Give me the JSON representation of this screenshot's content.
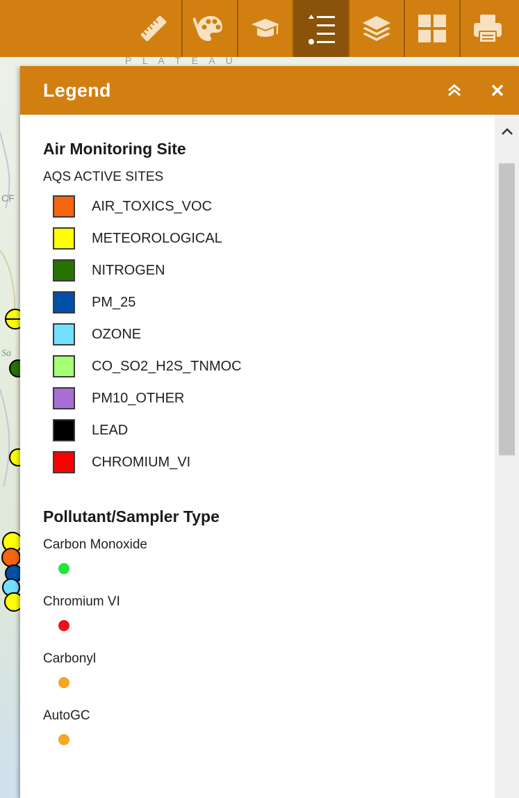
{
  "toolbar": {
    "tools": [
      {
        "name": "measure-button",
        "icon": "ruler-icon",
        "active": false
      },
      {
        "name": "symbology-button",
        "icon": "palette-icon",
        "active": false
      },
      {
        "name": "about-button",
        "icon": "graduation-cap-icon",
        "active": false
      },
      {
        "name": "legend-button",
        "icon": "list-icon",
        "active": true
      },
      {
        "name": "layers-button",
        "icon": "layers-icon",
        "active": false
      },
      {
        "name": "basemap-gallery-button",
        "icon": "grid-icon",
        "active": false
      },
      {
        "name": "print-button",
        "icon": "printer-icon",
        "active": false
      }
    ],
    "accent": "#d17f10",
    "active_color": "#8a5309"
  },
  "map": {
    "label_plateau": "P L A T E A U",
    "label_c": "CF",
    "label_sa": "Sa"
  },
  "legend_panel": {
    "title": "Legend",
    "collapse_icon": "double-chevron-up-icon",
    "close_icon": "close-icon",
    "sections": [
      {
        "title": "Air Monitoring Site",
        "layer_title": "AQS ACTIVE SITES",
        "items": [
          {
            "label": "AIR_TOXICS_VOC",
            "color": "#f5640f"
          },
          {
            "label": "METEOROLOGICAL",
            "color": "#ffff00"
          },
          {
            "label": "NITROGEN",
            "color": "#267300"
          },
          {
            "label": "PM_25",
            "color": "#0050a8"
          },
          {
            "label": "OZONE",
            "color": "#73dfff"
          },
          {
            "label": "CO_SO2_H2S_TNMOC",
            "color": "#a3ff73"
          },
          {
            "label": "PM10_OTHER",
            "color": "#a86fd6"
          },
          {
            "label": "LEAD",
            "color": "#000000"
          },
          {
            "label": "CHROMIUM_VI",
            "color": "#ff0000"
          }
        ]
      },
      {
        "title": "Pollutant/Sampler Type",
        "items": [
          {
            "label": "Carbon Monoxide",
            "color": "#1ee63a"
          },
          {
            "label": "Chromium VI",
            "color": "#e8141a"
          },
          {
            "label": "Carbonyl",
            "color": "#f5a623"
          },
          {
            "label": "AutoGC",
            "color": "#f5a623"
          }
        ]
      }
    ]
  }
}
